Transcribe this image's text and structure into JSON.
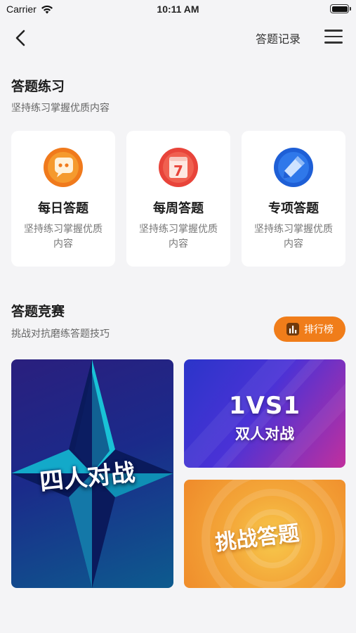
{
  "status_bar": {
    "carrier": "Carrier",
    "time": "10:11 AM"
  },
  "nav": {
    "history_label": "答题记录",
    "icons": {
      "back": "chevron-left-icon",
      "menu": "hamburger-menu-icon"
    }
  },
  "practice": {
    "title": "答题练习",
    "subtitle": "坚持练习掌握优质内容",
    "cards": [
      {
        "title": "每日答题",
        "desc": "坚持练习掌握优质内容",
        "icon": "chat-bubble-icon",
        "color": "#f07a1c"
      },
      {
        "title": "每周答题",
        "desc": "坚持练习掌握优质内容",
        "icon": "calendar-seven-icon",
        "color": "#e8443a",
        "icon_text": "7"
      },
      {
        "title": "专项答题",
        "desc": "坚持练习掌握优质内容",
        "icon": "pencil-icon",
        "color": "#1e5fd6"
      }
    ]
  },
  "competition": {
    "title": "答题竞赛",
    "subtitle": "挑战对抗磨练答题技巧",
    "rank_label": "排行榜",
    "battles": {
      "four": "四人对战",
      "one_v_one_title": "1VS1",
      "one_v_one_sub": "双人对战",
      "challenge": "挑战答题"
    }
  },
  "colors": {
    "accent": "#f07d1a",
    "background": "#f4f4f6"
  }
}
